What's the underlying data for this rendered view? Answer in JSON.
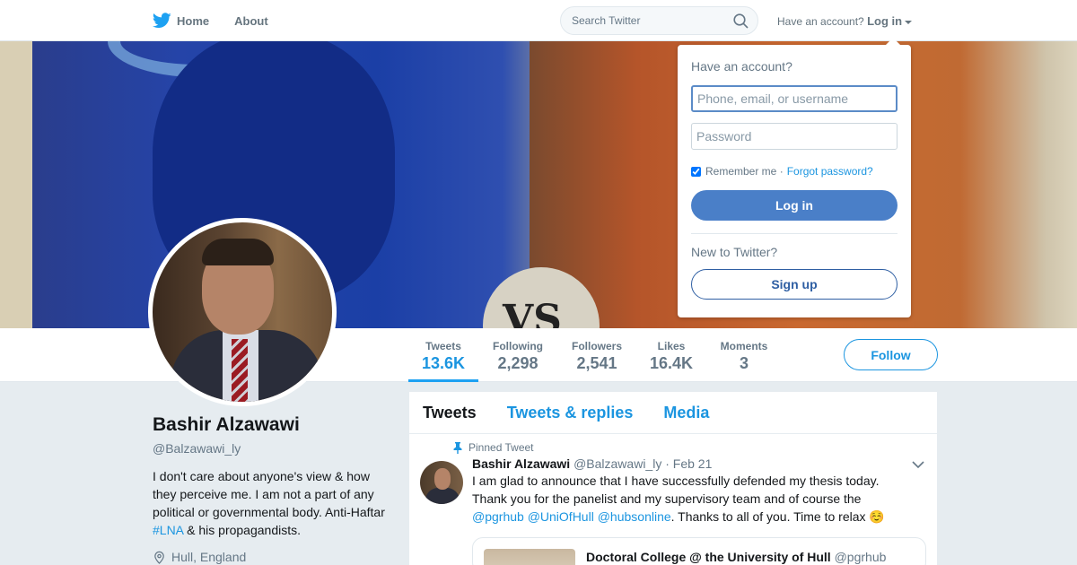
{
  "nav": {
    "home_label": "Home",
    "about_label": "About",
    "search_placeholder": "Search Twitter",
    "account_prompt": "Have an account?",
    "login_label": "Log in",
    "icons": [
      "twitter-bird-icon",
      "search-icon",
      "caret-down-icon"
    ]
  },
  "banner": {
    "vs_text": "VS"
  },
  "stats": [
    {
      "label": "Tweets",
      "value": "13.6K",
      "active": true
    },
    {
      "label": "Following",
      "value": "2,298"
    },
    {
      "label": "Followers",
      "value": "2,541"
    },
    {
      "label": "Likes",
      "value": "16.4K"
    },
    {
      "label": "Moments",
      "value": "3"
    }
  ],
  "follow_label": "Follow",
  "profile": {
    "name": "Bashir Alzawawi",
    "handle": "@Balzawawi_ly",
    "bio_text": "I don't care about anyone's view & how they perceive me. I am not a part of any political or governmental body. Anti-Haftar",
    "bio_hashtag": "#LNA",
    "bio_tail": "& his propagandists.",
    "location": "Hull, England"
  },
  "timeline": {
    "tabs": [
      "Tweets",
      "Tweets & replies",
      "Media"
    ],
    "pinned_label": "Pinned Tweet",
    "tweet": {
      "name": "Bashir Alzawawi",
      "handle": "@Balzawawi_ly",
      "date": "· Feb 21",
      "text_1": "I am glad to announce that I have successfully defended my thesis today. Thank you for the panelist and my supervisory team and of course the",
      "mention_1": "@pgrhub",
      "mention_2": "@UniOfHull",
      "mention_3": "@hubsonline",
      "text_2": ". Thanks to all of you. Time to relax ☺️"
    },
    "quote": {
      "name": "Doctoral College @ the University of Hull",
      "handle": "@pgrhub"
    }
  },
  "login_dropdown": {
    "title": "Have an account?",
    "username_placeholder": "Phone, email, or username",
    "password_placeholder": "Password",
    "remember_label": "Remember me ·",
    "remember_checked": true,
    "forgot_label": "Forgot password?",
    "login_button": "Log in",
    "new_prompt": "New to Twitter?",
    "signup_button": "Sign up"
  },
  "colors": {
    "accent": "#1b95e0",
    "login_button": "#4a7fc8",
    "page_bg": "#e6ecf0"
  }
}
